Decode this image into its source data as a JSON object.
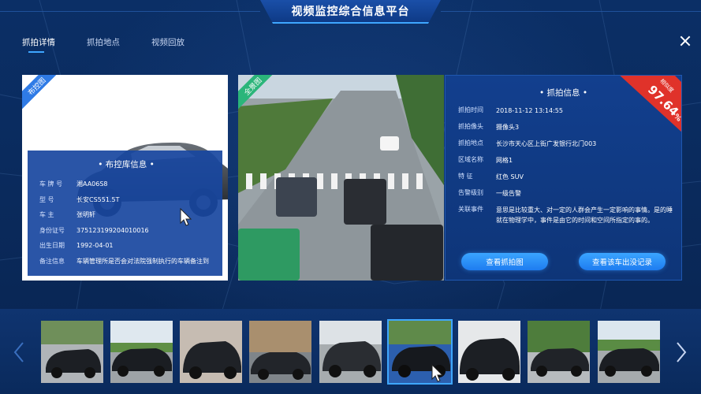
{
  "app": {
    "title": "视频监控综合信息平台"
  },
  "tabs": [
    {
      "label": "抓拍详情",
      "active": true
    },
    {
      "label": "抓拍地点",
      "active": false
    },
    {
      "label": "视频回放",
      "active": false
    }
  ],
  "left_panel": {
    "ribbon": "布控图",
    "card_title": "• 布控库信息 •",
    "rows": [
      {
        "key": "车 牌 号",
        "value": "湘AA06S8"
      },
      {
        "key": "型    号",
        "value": "长安CS551.5T"
      },
      {
        "key": "车    主",
        "value": "张明轩"
      },
      {
        "key": "身份证号",
        "value": "375123199204010016"
      },
      {
        "key": "出生日期",
        "value": "1992-04-01"
      },
      {
        "key": "备注信息",
        "value": "车辆管理所是否会对法院强制执行的车辆备注到"
      }
    ]
  },
  "scene": {
    "ribbon": "全景图"
  },
  "capture": {
    "title": "•  抓拍信息  •",
    "similarity_label": "相似度",
    "similarity": "97.64",
    "similarity_unit": "%",
    "rows": [
      {
        "key": "抓拍时间",
        "value": "2018-11-12 13:14:55"
      },
      {
        "key": "抓拍像头",
        "value": "摄像头3"
      },
      {
        "key": "抓拍地点",
        "value": "长沙市天心区上街广发银行北门003"
      },
      {
        "key": "区域名称",
        "value": "网格1"
      },
      {
        "key": "特    征",
        "value": "红色 SUV"
      },
      {
        "key": "告警级别",
        "value": "一级告警"
      },
      {
        "key": "关联事件",
        "value": "意思是比较重大、对一定的人群会产生一定影响的事情。是的睡就在物理学中，事件是由它的时间和空间所指定的事的。"
      }
    ],
    "btn_view_capture": "查看抓拍图",
    "btn_view_record": "查看该车出没记录"
  },
  "thumbnails": {
    "count": 9,
    "selected_index": 5
  },
  "colors": {
    "accent": "#3ea6ff",
    "badge_red": "#e0322a",
    "panel_blue": "#123f8e"
  }
}
